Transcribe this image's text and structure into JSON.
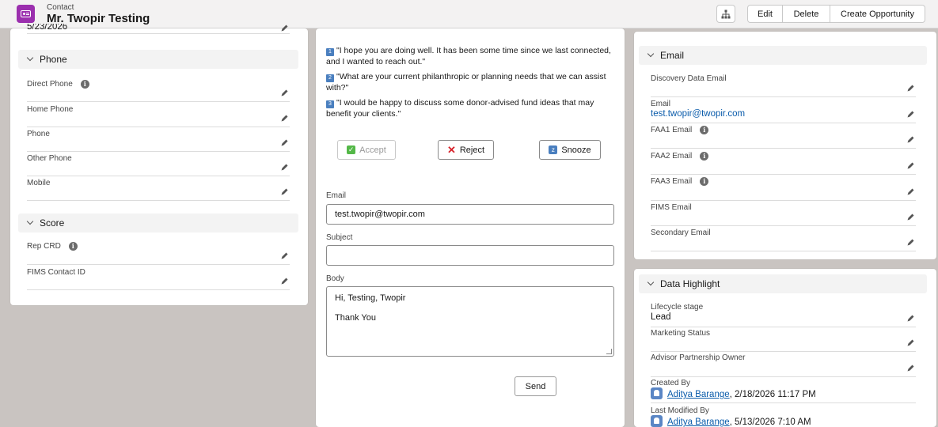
{
  "header": {
    "object_type": "Contact",
    "record_name": "Mr. Twopir Testing",
    "actions": {
      "edit": "Edit",
      "delete": "Delete",
      "create_opportunity": "Create Opportunity"
    }
  },
  "left": {
    "top_partial_value": "5/23/2026",
    "phone_section": "Phone",
    "phone_fields": [
      "Direct Phone",
      "Home Phone",
      "Phone",
      "Other Phone",
      "Mobile"
    ],
    "score_section": "Score",
    "score_fields": [
      "Rep CRD",
      "FIMS Contact ID"
    ]
  },
  "middle": {
    "messages": [
      "\"I hope you are doing well. It has been some time since we last connected, and I wanted to reach out.\"",
      "\"What are your current philanthropic or planning needs that we can assist with?\"",
      "\"I would be happy to discuss some donor-advised fund ideas that may benefit your clients.\""
    ],
    "buttons": {
      "accept": "Accept",
      "reject": "Reject",
      "snooze": "Snooze"
    },
    "email_label": "Email",
    "email_value": "test.twopir@twopir.com",
    "subject_label": "Subject",
    "subject_value": "",
    "body_label": "Body",
    "body_lines": [
      "Hi, Testing, Twopir",
      "Thank You"
    ],
    "send": "Send"
  },
  "email_panel": {
    "title": "Email",
    "fields": [
      {
        "label": "Discovery Data Email",
        "value": ""
      },
      {
        "label": "Email",
        "value": "test.twopir@twopir.com"
      },
      {
        "label": "FAA1 Email",
        "value": ""
      },
      {
        "label": "FAA2 Email",
        "value": ""
      },
      {
        "label": "FAA3 Email",
        "value": ""
      },
      {
        "label": "FIMS Email",
        "value": ""
      },
      {
        "label": "Secondary Email",
        "value": ""
      }
    ]
  },
  "highlight_panel": {
    "title": "Data Highlight",
    "lifecycle_label": "Lifecycle stage",
    "lifecycle_value": "Lead",
    "marketing_label": "Marketing Status",
    "advisor_label": "Advisor Partnership Owner",
    "created_label": "Created By",
    "created_user": "Aditya Barange",
    "created_date": ", 2/18/2026 11:17 PM",
    "modified_label": "Last Modified By",
    "modified_user": "Aditya Barange",
    "modified_date": ", 5/13/2026 7:10 AM"
  },
  "colors": {
    "accent": "#0b5cab",
    "record_icon": "#9b2fae",
    "section_bg": "#f3f3f3",
    "backdrop": "#c9c4c1"
  }
}
